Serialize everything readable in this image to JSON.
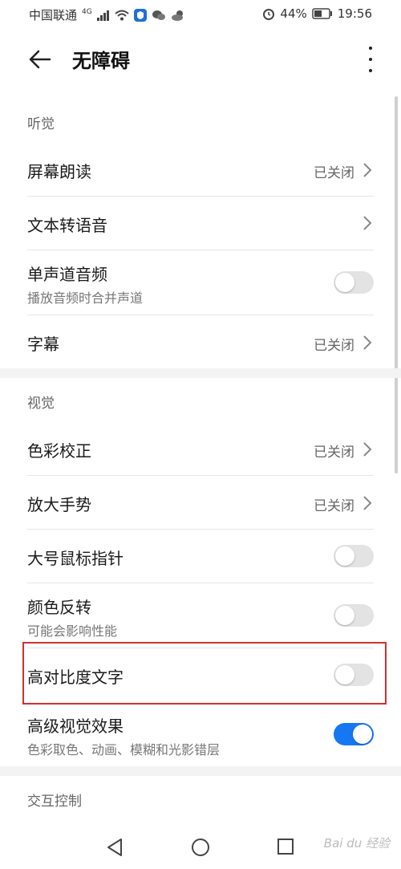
{
  "status_bar": {
    "carrier": "中国联通",
    "network": "4G",
    "battery": "44%",
    "time": "19:56"
  },
  "header": {
    "title": "无障碍"
  },
  "sections": {
    "hearing": {
      "label": "听觉",
      "items": [
        {
          "title": "屏幕朗读",
          "value": "已关闭"
        },
        {
          "title": "文本转语音"
        },
        {
          "title": "单声道音频",
          "subtitle": "播放音频时合并声道",
          "toggle_on": false
        },
        {
          "title": "字幕",
          "value": "已关闭"
        }
      ]
    },
    "vision": {
      "label": "视觉",
      "items": [
        {
          "title": "色彩校正",
          "value": "已关闭"
        },
        {
          "title": "放大手势",
          "value": "已关闭"
        },
        {
          "title": "大号鼠标指针",
          "toggle_on": false
        },
        {
          "title": "颜色反转",
          "subtitle": "可能会影响性能",
          "toggle_on": false
        },
        {
          "title": "高对比度文字",
          "toggle_on": false
        },
        {
          "title": "高级视觉效果",
          "subtitle": "色彩取色、动画、模糊和光影错层",
          "toggle_on": true
        }
      ]
    },
    "interaction": {
      "label": "交互控制"
    }
  },
  "watermark": "Bai du 经验",
  "colors": {
    "accent": "#1677f2",
    "highlight_border": "#d32f2f"
  }
}
